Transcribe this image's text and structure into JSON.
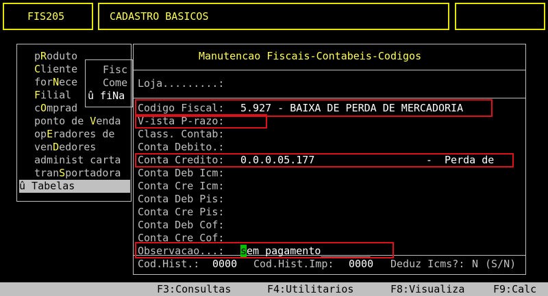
{
  "header": {
    "code": "FIS205",
    "title": "CADASTRO BASICOS"
  },
  "menu": {
    "items": [
      {
        "label": "pRoduto",
        "hot": "R"
      },
      {
        "label": "Cliente",
        "hot": "C"
      },
      {
        "label": "forNece",
        "hot": "N"
      },
      {
        "label": "Filial",
        "hot": "F"
      },
      {
        "label": "cOmprad",
        "hot": "O"
      },
      {
        "label": "ponto de Venda",
        "hot": "V"
      },
      {
        "label": "opEradores de",
        "hot": "E"
      },
      {
        "label": "venDedores",
        "hot": "D"
      },
      {
        "label": "administ carta",
        "hot": ""
      },
      {
        "label": "tranSportadora",
        "hot": "S"
      },
      {
        "label": "û Tabelas",
        "hot": ""
      }
    ],
    "submenu": [
      "Fisc",
      "Come",
      "û fiNa"
    ]
  },
  "form": {
    "title": "Manutencao Fiscais-Contabeis-Codigos",
    "loja_label": "Loja.........:",
    "fields": [
      {
        "label": "Codigo Fiscal:",
        "value": "5.927 - BAIXA DE PERDA DE MERCADORIA"
      },
      {
        "label": "V-ista P-razo:",
        "value": ""
      },
      {
        "label": "Class. Contab:",
        "value": ""
      },
      {
        "label": "Conta Debito.:",
        "value": ""
      },
      {
        "label": "Conta Credito:",
        "value": "0.0.0.05.177                  -  Perda de"
      },
      {
        "label": "Conta Deb Icm:",
        "value": ""
      },
      {
        "label": "Conta Cre Icm:",
        "value": ""
      },
      {
        "label": "Conta Deb Pis:",
        "value": ""
      },
      {
        "label": "Conta Cre Pis:",
        "value": ""
      },
      {
        "label": "Conta Deb Cof:",
        "value": ""
      },
      {
        "label": "Conta Cre Cof:",
        "value": ""
      }
    ],
    "observacao_label": "Observacao...:",
    "observacao_cursor": "s",
    "observacao_value": "em pagamento________",
    "cod_hist_label": "Cod.Hist.:",
    "cod_hist_value": "0000",
    "cod_hist_imp_label": "Cod.Hist.Imp:",
    "cod_hist_imp_value": "0000",
    "deduz_label": "Deduz Icms?:",
    "deduz_value": "N",
    "deduz_options": "(S/N)"
  },
  "statusbar": {
    "f3": "F3:Consultas",
    "f4": "F4:Utilitarios",
    "f8": "F8:Visualiza",
    "f9": "F9:Calc"
  },
  "colors": {
    "background": "#000000",
    "text": "#c0c0c0",
    "highlight": "#ffff55",
    "annotation_red": "#e0101a",
    "cursor": "#00c000"
  }
}
